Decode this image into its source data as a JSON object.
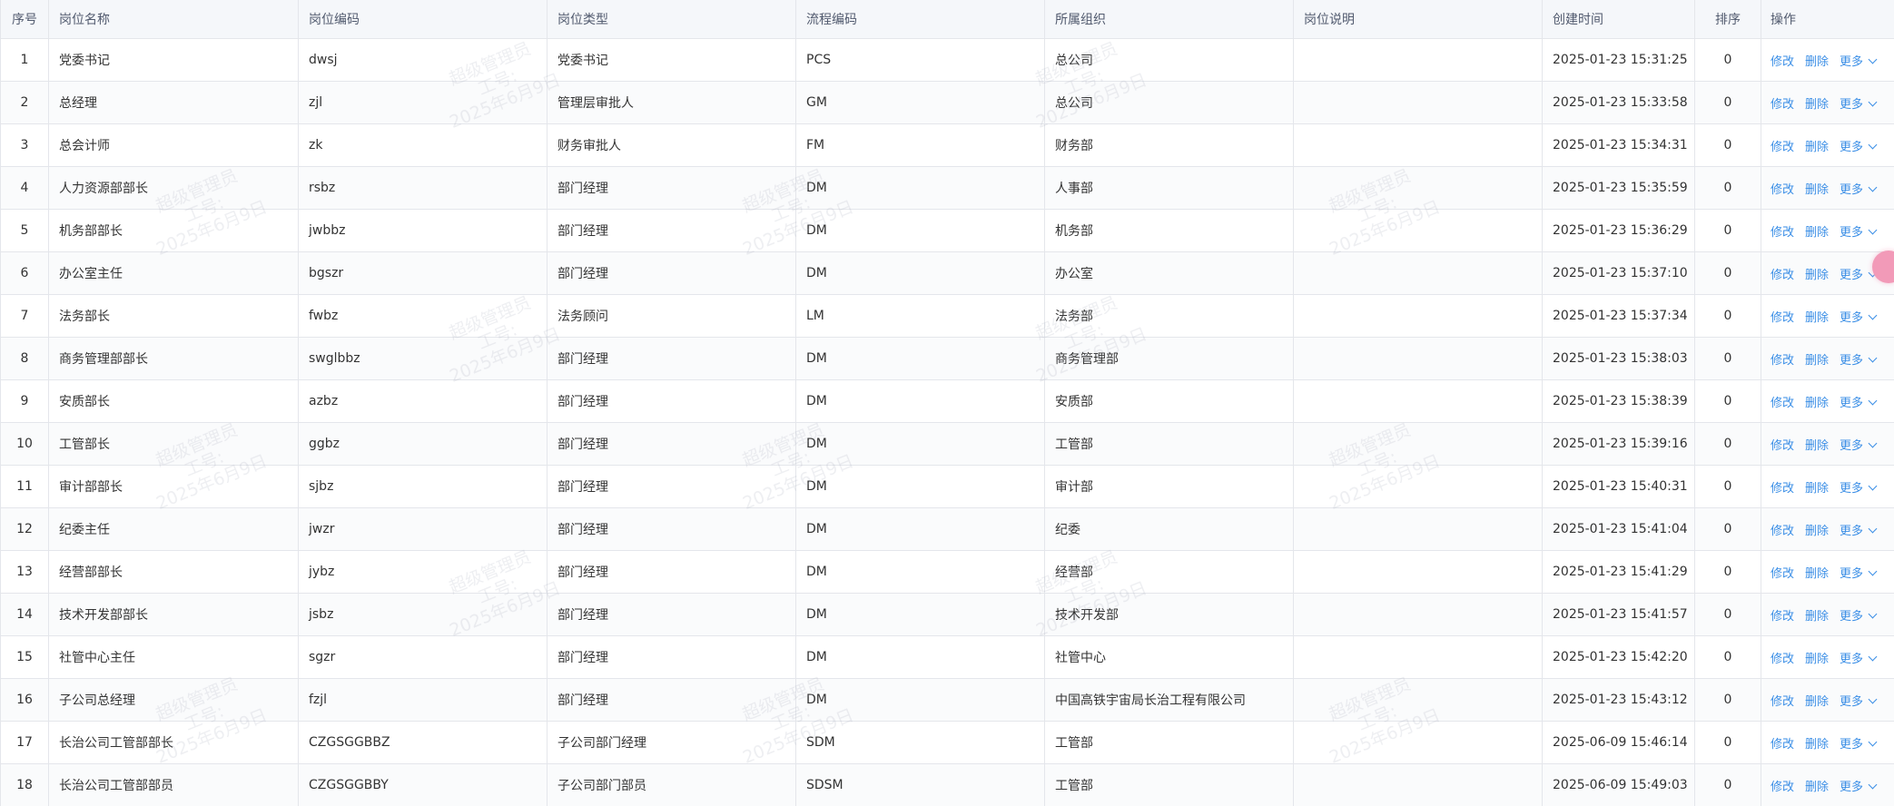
{
  "table": {
    "columns": {
      "index": "序号",
      "name": "岗位名称",
      "code": "岗位编码",
      "type": "岗位类型",
      "flow": "流程编码",
      "org": "所属组织",
      "desc": "岗位说明",
      "created": "创建时间",
      "sort": "排序",
      "actions": "操作"
    },
    "action_labels": {
      "edit": "修改",
      "delete": "删除",
      "more": "更多"
    },
    "rows": [
      {
        "index": "1",
        "name": "党委书记",
        "code": "dwsj",
        "type": "党委书记",
        "flow": "PCS",
        "org": "总公司",
        "desc": "",
        "created": "2025-01-23 15:31:25",
        "sort": "0"
      },
      {
        "index": "2",
        "name": "总经理",
        "code": "zjl",
        "type": "管理层审批人",
        "flow": "GM",
        "org": "总公司",
        "desc": "",
        "created": "2025-01-23 15:33:58",
        "sort": "0"
      },
      {
        "index": "3",
        "name": "总会计师",
        "code": "zk",
        "type": "财务审批人",
        "flow": "FM",
        "org": "财务部",
        "desc": "",
        "created": "2025-01-23 15:34:31",
        "sort": "0"
      },
      {
        "index": "4",
        "name": "人力资源部部长",
        "code": "rsbz",
        "type": "部门经理",
        "flow": "DM",
        "org": "人事部",
        "desc": "",
        "created": "2025-01-23 15:35:59",
        "sort": "0"
      },
      {
        "index": "5",
        "name": "机务部部长",
        "code": "jwbbz",
        "type": "部门经理",
        "flow": "DM",
        "org": "机务部",
        "desc": "",
        "created": "2025-01-23 15:36:29",
        "sort": "0"
      },
      {
        "index": "6",
        "name": "办公室主任",
        "code": "bgszr",
        "type": "部门经理",
        "flow": "DM",
        "org": "办公室",
        "desc": "",
        "created": "2025-01-23 15:37:10",
        "sort": "0"
      },
      {
        "index": "7",
        "name": "法务部长",
        "code": "fwbz",
        "type": "法务顾问",
        "flow": "LM",
        "org": "法务部",
        "desc": "",
        "created": "2025-01-23 15:37:34",
        "sort": "0"
      },
      {
        "index": "8",
        "name": "商务管理部部长",
        "code": "swglbbz",
        "type": "部门经理",
        "flow": "DM",
        "org": "商务管理部",
        "desc": "",
        "created": "2025-01-23 15:38:03",
        "sort": "0"
      },
      {
        "index": "9",
        "name": "安质部长",
        "code": "azbz",
        "type": "部门经理",
        "flow": "DM",
        "org": "安质部",
        "desc": "",
        "created": "2025-01-23 15:38:39",
        "sort": "0"
      },
      {
        "index": "10",
        "name": "工管部长",
        "code": "ggbz",
        "type": "部门经理",
        "flow": "DM",
        "org": "工管部",
        "desc": "",
        "created": "2025-01-23 15:39:16",
        "sort": "0"
      },
      {
        "index": "11",
        "name": "审计部部长",
        "code": "sjbz",
        "type": "部门经理",
        "flow": "DM",
        "org": "审计部",
        "desc": "",
        "created": "2025-01-23 15:40:31",
        "sort": "0"
      },
      {
        "index": "12",
        "name": "纪委主任",
        "code": "jwzr",
        "type": "部门经理",
        "flow": "DM",
        "org": "纪委",
        "desc": "",
        "created": "2025-01-23 15:41:04",
        "sort": "0"
      },
      {
        "index": "13",
        "name": "经营部部长",
        "code": "jybz",
        "type": "部门经理",
        "flow": "DM",
        "org": "经营部",
        "desc": "",
        "created": "2025-01-23 15:41:29",
        "sort": "0"
      },
      {
        "index": "14",
        "name": "技术开发部部长",
        "code": "jsbz",
        "type": "部门经理",
        "flow": "DM",
        "org": "技术开发部",
        "desc": "",
        "created": "2025-01-23 15:41:57",
        "sort": "0"
      },
      {
        "index": "15",
        "name": "社管中心主任",
        "code": "sgzr",
        "type": "部门经理",
        "flow": "DM",
        "org": "社管中心",
        "desc": "",
        "created": "2025-01-23 15:42:20",
        "sort": "0"
      },
      {
        "index": "16",
        "name": "子公司总经理",
        "code": "fzjl",
        "type": "部门经理",
        "flow": "DM",
        "org": "中国高铁宇宙局长治工程有限公司",
        "desc": "",
        "created": "2025-01-23 15:43:12",
        "sort": "0"
      },
      {
        "index": "17",
        "name": "长治公司工管部部长",
        "code": "CZGSGGBBZ",
        "type": "子公司部门经理",
        "flow": "SDM",
        "org": "工管部",
        "desc": "",
        "created": "2025-06-09 15:46:14",
        "sort": "0"
      },
      {
        "index": "18",
        "name": "长治公司工管部部员",
        "code": "CZGSGGBBY",
        "type": "子公司部门部员",
        "flow": "SDSM",
        "org": "工管部",
        "desc": "",
        "created": "2025-06-09 15:49:03",
        "sort": "0"
      }
    ]
  },
  "watermark": {
    "line1": "超级管理员",
    "line2": "工号:",
    "line3": "2025年6月9日"
  },
  "colors": {
    "link": "#3a8ee6",
    "header_bg": "#f5f7fa",
    "border": "#e4e6eb",
    "float_badge": "#f29ab8"
  },
  "icons": {
    "more_dropdown": "chevron-down-icon",
    "floating_button": "floating-assistant-icon"
  }
}
